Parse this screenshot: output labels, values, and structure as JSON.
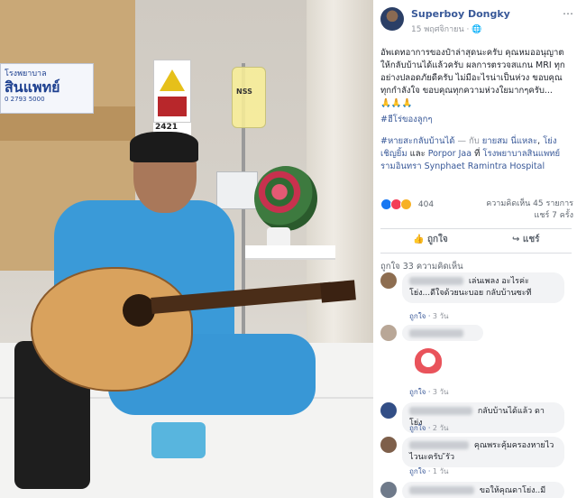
{
  "photo": {
    "hospital_sign_small": "โรงพยาบาล",
    "hospital_sign_big": "สินแพทย์",
    "hospital_sign_phone": "0 2793 5000",
    "room_number": "2421",
    "iv_label": "NSS"
  },
  "post": {
    "author": "Superboy Dongky",
    "meta": "15 พฤศจิกายน · ",
    "text": "อัพเดทอาการของป๋าล่าสุดนะครับ คุณหมออนุญาตให้กลับบ้านได้แล้วครับ ผลการตรวจสแกน MRI ทุกอย่างปลอดภัยดีครับ ไม่มีอะไรน่าเป็นห่วง ขอบคุณทุกกำลังใจ ขอบคุณทุกความห่วงใยมากๆครับ...",
    "emoji_line": "🙏🙏🙏",
    "hashtag": "#ฮีโร่ของลูกๆ",
    "tag_line": {
      "hashtag": "#หายสะกลับบ้านได้",
      "with_text": " — กับ ",
      "person1": "ยายสม นี่แหละ",
      "comma": ", ",
      "person2": "โย่ง เชิญยิ้ม",
      "and_text": " และ ",
      "person3": "Porpor Jaa",
      "at_text": " ที่ ",
      "place": "โรงพยาบาลสินแพทย์ รามอินทรา Synphaet Ramintra Hospital"
    },
    "reaction_count": "404",
    "comment_count": "ความคิดเห็น 45 รายการ",
    "share_count": "แชร์ 7 ครั้ง",
    "like_label": "ถูกใจ",
    "share_label": "แชร์",
    "comments_header": "ถูกใจ 33 ความคิดเห็น"
  },
  "comments": [
    {
      "text": " เล่นเพลง อะไรค่ะโย่ง...ดีใจด้วยนะบอย กลับบ้านซะที",
      "like": "ถูกใจ",
      "time": "3 วัน"
    },
    {
      "text": "",
      "like": "ถูกใจ",
      "time": "3 วัน"
    },
    {
      "text": " กลับบ้านได้แล้ว ดาโย่ง",
      "like": "ถูกใจ",
      "time": "2 วัน"
    },
    {
      "text": " คุณพระคุ้มครองหายไวไวนะครับ ัรัว",
      "like": "ถูกใจ",
      "time": "1 วัน"
    },
    {
      "text": " ขอให้คุณดาโย่ง..มี",
      "like": "",
      "time": ""
    }
  ],
  "icons": {
    "more": "⋯",
    "globe": "🌐",
    "like": "👍",
    "share": "↪"
  }
}
